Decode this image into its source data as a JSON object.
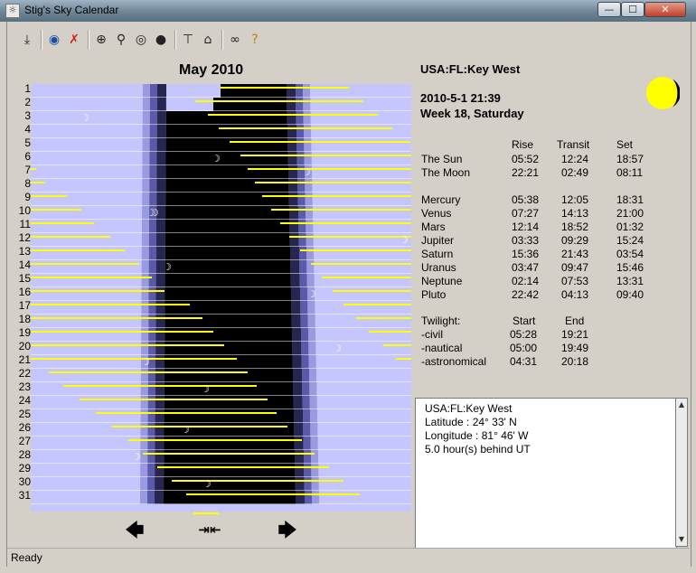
{
  "window": {
    "title": "Stig's Sky Calendar",
    "minimize": "—",
    "maximize": "☐",
    "close": "✕"
  },
  "toolbar": {
    "icons": [
      "save-icon",
      "globe-icon",
      "satellite-icon",
      "crosshair-icon",
      "magnifier-icon",
      "target-icon",
      "starfield-icon",
      "telescope-icon",
      "home-icon",
      "binoculars-icon",
      "help-icon"
    ]
  },
  "calendar": {
    "month_title": "May 2010",
    "days": [
      "1",
      "2",
      "3",
      "4",
      "5",
      "6",
      "7",
      "8",
      "9",
      "10",
      "11",
      "12",
      "13",
      "14",
      "15",
      "16",
      "17",
      "18",
      "19",
      "20",
      "21",
      "22",
      "23",
      "24",
      "25",
      "26",
      "27",
      "28",
      "29",
      "30",
      "31"
    ],
    "colors": {
      "day": "#c6c6ff",
      "civil": "#9a9ae0",
      "nautical": "#5a5aa8",
      "astro": "#262650",
      "night": "#000000",
      "planet_line": "#ffff00",
      "moon": "#ffffff"
    }
  },
  "info": {
    "location": "USA:FL:Key West",
    "datetime": "2010-5-1 21:39",
    "week": "Week 18, Saturday",
    "headers": {
      "rise": "Rise",
      "transit": "Transit",
      "set": "Set"
    },
    "bodies": [
      {
        "name": "The Sun",
        "rise": "05:52",
        "transit": "12:24",
        "set": "18:57"
      },
      {
        "name": "The Moon",
        "rise": "22:21",
        "transit": "02:49",
        "set": "08:11"
      },
      {
        "name": "Mercury",
        "rise": "05:38",
        "transit": "12:05",
        "set": "18:31"
      },
      {
        "name": "Venus",
        "rise": "07:27",
        "transit": "14:13",
        "set": "21:00"
      },
      {
        "name": "Mars",
        "rise": "12:14",
        "transit": "18:52",
        "set": "01:32"
      },
      {
        "name": "Jupiter",
        "rise": "03:33",
        "transit": "09:29",
        "set": "15:24"
      },
      {
        "name": "Saturn",
        "rise": "15:36",
        "transit": "21:43",
        "set": "03:54"
      },
      {
        "name": "Uranus",
        "rise": "03:47",
        "transit": "09:47",
        "set": "15:46"
      },
      {
        "name": "Neptune",
        "rise": "02:14",
        "transit": "07:53",
        "set": "13:31"
      },
      {
        "name": "Pluto",
        "rise": "22:42",
        "transit": "04:13",
        "set": "09:40"
      }
    ],
    "twilight": {
      "title": "Twilight:",
      "start": "Start",
      "end": "End",
      "rows": [
        {
          "name": "-civil",
          "start": "05:28",
          "end": "19:21"
        },
        {
          "name": "-nautical",
          "start": "05:00",
          "end": "19:49"
        },
        {
          "name": "-astronomical",
          "start": "04:31",
          "end": "20:18"
        }
      ]
    }
  },
  "location_box": {
    "lines": [
      "USA:FL:Key West",
      "Latitude : 24° 33' N",
      "Longitude : 81° 46' W",
      "5.0 hour(s) behind UT"
    ]
  },
  "nav": {
    "prev": "🡄",
    "today": "⇥⇤",
    "next": "🡆"
  },
  "status": {
    "text": "Ready"
  }
}
